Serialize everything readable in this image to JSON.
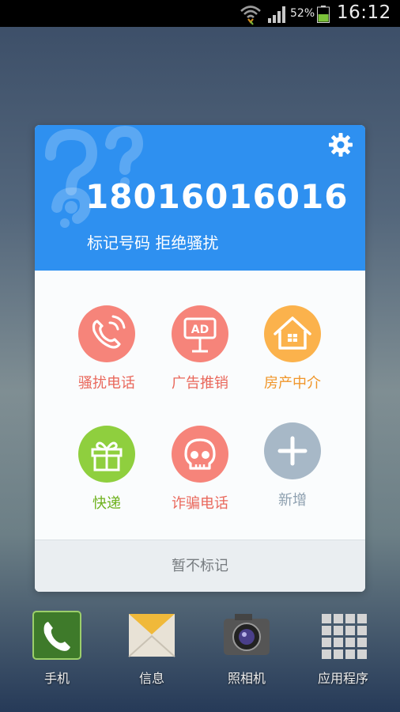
{
  "status_bar": {
    "battery_percent": "52%",
    "time": "16:12"
  },
  "dialog": {
    "phone_number": "18016016016",
    "subtitle": "标记号码  拒绝骚扰",
    "options": [
      {
        "label": "骚扰电话",
        "icon": "phone-harass-icon",
        "color": "#f6847a",
        "label_color": "#e9675b"
      },
      {
        "label": "广告推销",
        "icon": "ad-sign-icon",
        "color": "#f6847a",
        "label_color": "#e9675b"
      },
      {
        "label": "房产中介",
        "icon": "house-icon",
        "color": "#fbb24c",
        "label_color": "#f0962a"
      },
      {
        "label": "快递",
        "icon": "gift-icon",
        "color": "#8fcf3e",
        "label_color": "#6fb21f"
      },
      {
        "label": "诈骗电话",
        "icon": "skull-icon",
        "color": "#f6847a",
        "label_color": "#e9675b"
      },
      {
        "label": "新增",
        "icon": "plus-icon",
        "color": "#a7b8c7",
        "label_color": "#8ea0b0"
      }
    ],
    "footer_label": "暂不标记",
    "header_color": "#2e90f0"
  },
  "dock": [
    {
      "label": "手机",
      "icon": "phone-app-icon"
    },
    {
      "label": "信息",
      "icon": "messages-app-icon"
    },
    {
      "label": "照相机",
      "icon": "camera-app-icon"
    },
    {
      "label": "应用程序",
      "icon": "apps-grid-icon"
    }
  ]
}
